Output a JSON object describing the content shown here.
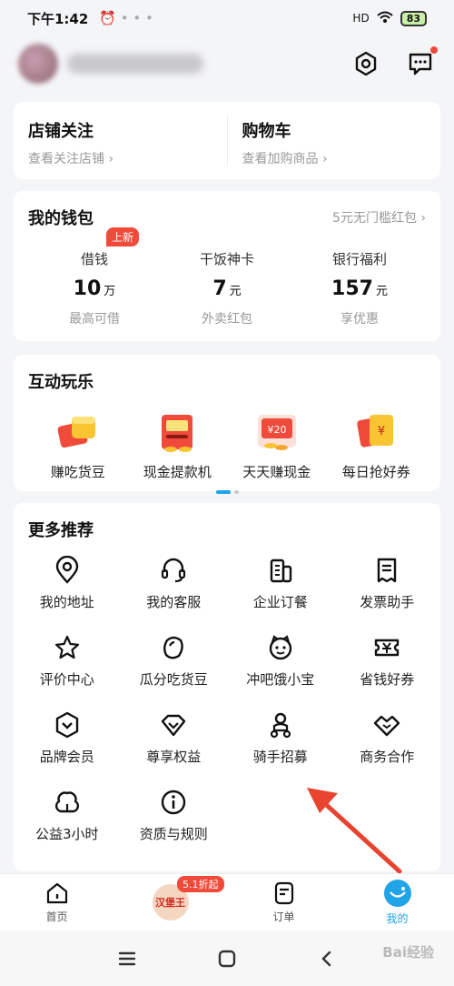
{
  "status_bar": {
    "time": "下午1:42",
    "battery": "83",
    "network": "HD"
  },
  "header": {
    "settings_icon": "settings-icon",
    "message_icon": "message-icon"
  },
  "shop": {
    "follow_title": "店铺关注",
    "follow_sub": "查看关注店铺 ›",
    "cart_title": "购物车",
    "cart_sub": "查看加购商品 ›"
  },
  "wallet": {
    "title": "我的钱包",
    "link": "5元无门槛红包 ›",
    "items": [
      {
        "label": "借钱",
        "value": "10",
        "unit": "万",
        "desc": "最高可借",
        "badge": "上新"
      },
      {
        "label": "干饭神卡",
        "value": "7",
        "unit": "元",
        "desc": "外卖红包"
      },
      {
        "label": "银行福利",
        "value": "157",
        "unit": "元",
        "desc": "享优惠"
      }
    ]
  },
  "fun": {
    "title": "互动玩乐",
    "items": [
      {
        "label": "赚吃货豆"
      },
      {
        "label": "现金提款机"
      },
      {
        "label": "天天赚现金",
        "tag": "¥20"
      },
      {
        "label": "每日抢好券",
        "tag": "¥"
      }
    ]
  },
  "more": {
    "title": "更多推荐",
    "items": [
      {
        "label": "我的地址",
        "icon": "location-icon"
      },
      {
        "label": "我的客服",
        "icon": "headset-icon"
      },
      {
        "label": "企业订餐",
        "icon": "building-icon"
      },
      {
        "label": "发票助手",
        "icon": "invoice-icon"
      },
      {
        "label": "评价中心",
        "icon": "star-icon"
      },
      {
        "label": "瓜分吃货豆",
        "icon": "bean-icon"
      },
      {
        "label": "冲吧饿小宝",
        "icon": "mascot-icon"
      },
      {
        "label": "省钱好券",
        "icon": "coupon-icon"
      },
      {
        "label": "品牌会员",
        "icon": "brand-member-icon"
      },
      {
        "label": "尊享权益",
        "icon": "benefit-icon"
      },
      {
        "label": "骑手招募",
        "icon": "rider-icon"
      },
      {
        "label": "商务合作",
        "icon": "handshake-icon"
      },
      {
        "label": "公益3小时",
        "icon": "charity-icon"
      },
      {
        "label": "资质与规则",
        "icon": "info-icon"
      }
    ]
  },
  "tabbar": {
    "home": "首页",
    "promo_badge": "5.1折起",
    "promo_logo": "汉堡王",
    "orders": "订单",
    "mine": "我的"
  },
  "watermark": "Bai经验",
  "colors": {
    "accent": "#21a3e8",
    "red": "#f04a3a",
    "annotation_arrow": "#e8432f"
  }
}
